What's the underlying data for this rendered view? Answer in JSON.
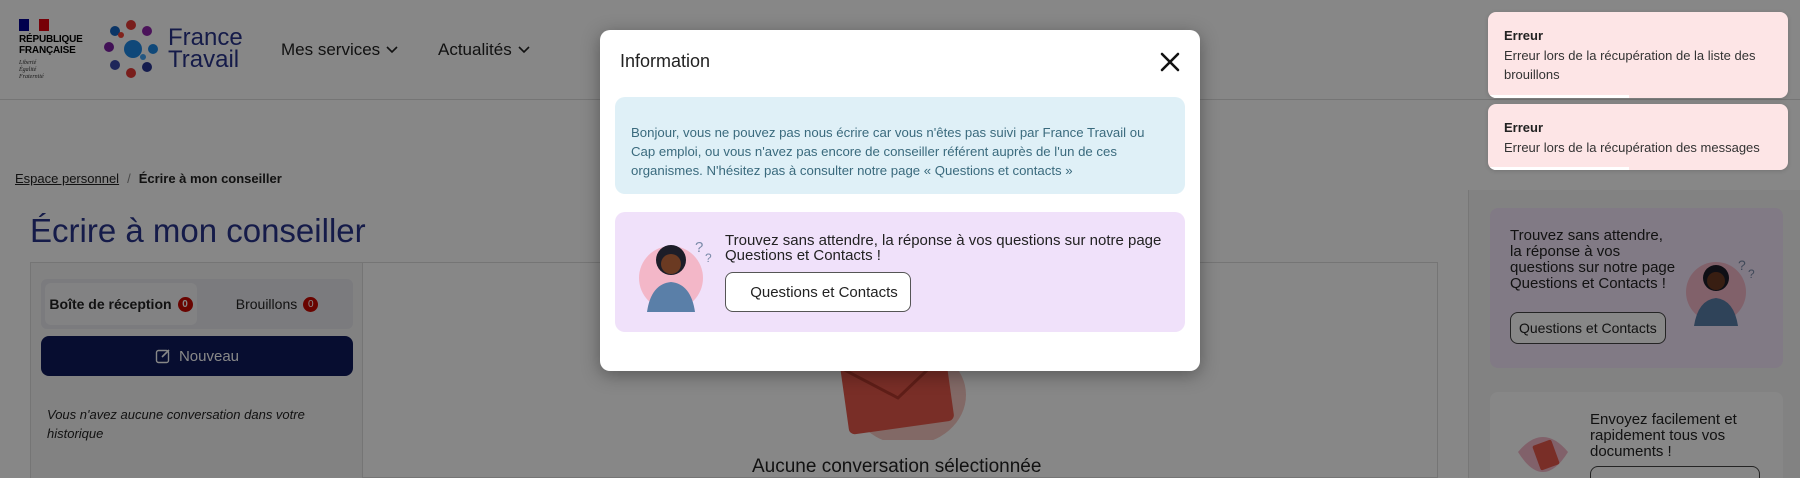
{
  "header": {
    "rf_name": [
      "RÉPUBLIQUE",
      "FRANÇAISE"
    ],
    "rf_motto": [
      "Liberté",
      "Égalité",
      "Fraternité"
    ],
    "brand": [
      "France",
      "Travail"
    ],
    "nav": [
      {
        "label": "Mes services"
      },
      {
        "label": "Actualités"
      }
    ]
  },
  "breadcrumb": {
    "parent": "Espace personnel",
    "separator": "/",
    "current": "Écrire à mon conseiller"
  },
  "page": {
    "title": "Écrire à mon conseiller",
    "tabs": [
      {
        "label": "Boîte de réception",
        "count": "0"
      },
      {
        "label": "Brouillons",
        "count": "0"
      }
    ],
    "new_button": "Nouveau",
    "empty_history": "Vous n'avez aucune conversation dans votre historique",
    "no_selection": "Aucune conversation sélectionnée"
  },
  "sidebar": {
    "card1_text": "Trouvez sans attendre, la réponse à vos questions sur notre page Questions et Contacts !",
    "card1_button": "Questions et Contacts",
    "card2_text": "Envoyez facilement et rapidement tous vos documents !"
  },
  "modal": {
    "title": "Information",
    "info_text": "Bonjour, vous ne pouvez pas nous écrire car vous n'êtes pas suivi par France Travail ou Cap emploi, ou vous n'avez pas encore de conseiller référent auprès de l'un de ces organismes. N'hésitez pas à consulter notre page « Questions et contacts »",
    "promo_text": "Trouvez sans attendre, la réponse à vos questions sur notre page Questions et Contacts !",
    "promo_button": "Questions et Contacts"
  },
  "toasts": [
    {
      "title": "Erreur",
      "message": "Erreur lors de la récupération de la liste des brouillons",
      "progress": 0.47
    },
    {
      "title": "Erreur",
      "message": "Erreur lors de la récupération des messages",
      "progress": 0.47
    }
  ],
  "colors": {
    "brand_blue": "#28348a",
    "navy_button": "#0f1a5c",
    "badge_red": "#c60800",
    "info_bg": "#dff0f7",
    "promo_bg": "#f0e1fa",
    "toast_bg": "#fde5e6"
  },
  "icons": {
    "close": "close-icon",
    "chevron": "chevron-down-icon",
    "edit": "edit-icon"
  }
}
